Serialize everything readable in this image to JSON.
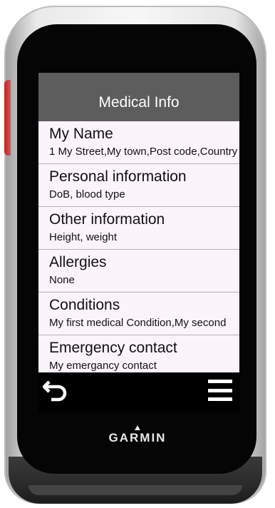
{
  "screen": {
    "title": "Medical Info"
  },
  "list": {
    "items": [
      {
        "title": "My Name",
        "subtitle": "1 My Street,My town,Post code,Country"
      },
      {
        "title": "Personal information",
        "subtitle": "DoB, blood type"
      },
      {
        "title": "Other information",
        "subtitle": "Height, weight"
      },
      {
        "title": "Allergies",
        "subtitle": "None"
      },
      {
        "title": "Conditions",
        "subtitle": "My first medical Condition,My second"
      },
      {
        "title": "Emergency contact",
        "subtitle": "My emergancy contact"
      }
    ]
  },
  "toolbar": {
    "back_icon": "back-arrow-icon",
    "menu_icon": "hamburger-menu-icon"
  },
  "device": {
    "brand": "GARMIN",
    "accent_color": "#d33a3a",
    "header_color": "#5d5d5d"
  }
}
